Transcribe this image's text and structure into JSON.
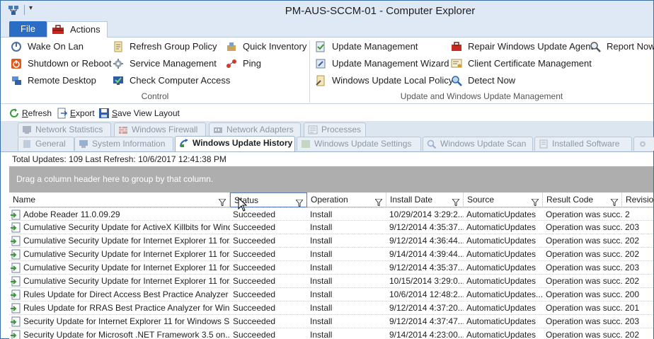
{
  "window": {
    "title": "PM-AUS-SCCM-01 - Computer Explorer"
  },
  "ribbon_tabs": {
    "file": "File",
    "actions": "Actions"
  },
  "ribbon": {
    "control": {
      "label": "Control",
      "buttons": [
        "Wake On Lan",
        "Shutdown or Reboot",
        "Remote Desktop",
        "Refresh Group Policy",
        "Service Management",
        "Check Computer Access",
        "Quick Inventory",
        "Ping"
      ]
    },
    "update": {
      "label": "Update and Windows Update Management",
      "buttons": [
        "Update Management",
        "Update Management Wizard",
        "Windows Update Local Policy",
        "Repair Windows Update Agent",
        "Client Certificate Management",
        "Detect Now",
        "Report Now"
      ]
    }
  },
  "toolbar": {
    "refresh": "Refresh",
    "export": "Export",
    "save_layout": "Save View Layout"
  },
  "subtabs": {
    "row1": [
      "Network Statistics",
      "Windows Firewall",
      "Network Adapters",
      "Processes"
    ],
    "row2": [
      "General",
      "System Information",
      "Windows Update History",
      "Windows Update Settings",
      "Windows Update Scan",
      "Installed Software"
    ],
    "active": "Windows Update History"
  },
  "info": {
    "summary": "Total Updates: 109 Last Refresh: 10/6/2017 12:41:38 PM"
  },
  "group_panel": {
    "text": "Drag a column header here to group by that column."
  },
  "grid": {
    "columns": [
      "Name",
      "Status",
      "Operation",
      "Install Date",
      "Source",
      "Result Code",
      "Revisio"
    ],
    "rows": [
      [
        "Adobe Reader 11.0.09.29",
        "Succeeded",
        "Install",
        "10/29/2014  3:29:2...",
        "AutomaticUpdates",
        "Operation was succ...",
        "2"
      ],
      [
        "Cumulative Security Update for ActiveX Killbits for Wind...",
        "Succeeded",
        "Install",
        "9/12/2014  4:35:37...",
        "AutomaticUpdates",
        "Operation was succ...",
        "203"
      ],
      [
        "Cumulative Security Update for Internet Explorer 11 for...",
        "Succeeded",
        "Install",
        "9/12/2014  4:36:44...",
        "AutomaticUpdates",
        "Operation was succ...",
        "202"
      ],
      [
        "Cumulative Security Update for Internet Explorer 11 for...",
        "Succeeded",
        "Install",
        "9/14/2014  4:39:44...",
        "AutomaticUpdates",
        "Operation was succ...",
        "202"
      ],
      [
        "Cumulative Security Update for Internet Explorer 11 for...",
        "Succeeded",
        "Install",
        "9/12/2014  4:35:37...",
        "AutomaticUpdates",
        "Operation was succ...",
        "203"
      ],
      [
        "Cumulative Security Update for Internet Explorer 11 for...",
        "Succeeded",
        "Install",
        "10/15/2014  3:29:0...",
        "AutomaticUpdates",
        "Operation was succ...",
        "202"
      ],
      [
        "Rules Update for Direct Access Best Practice Analyzer f...",
        "Succeeded",
        "Install",
        "10/6/2014  12:48:2...",
        "AutomaticUpdates...",
        "Operation was succ...",
        "200"
      ],
      [
        "Rules Update for RRAS Best Practice Analyzer for Win...",
        "Succeeded",
        "Install",
        "9/12/2014  4:37:20...",
        "AutomaticUpdates",
        "Operation was succ...",
        "201"
      ],
      [
        "Security Update for Internet Explorer 11 for Windows S...",
        "Succeeded",
        "Install",
        "9/12/2014  4:37:47...",
        "AutomaticUpdates",
        "Operation was succ...",
        "203"
      ],
      [
        "Security Update for Microsoft .NET Framework 3.5 on...",
        "Succeeded",
        "Install",
        "9/14/2014  4:23:00...",
        "AutomaticUpdates",
        "Operation was succ...",
        "202"
      ]
    ]
  },
  "colors": {
    "file_tab": "#2b6cc4",
    "titlebar": "#dfe9f5",
    "group_panel": "#aeaeae",
    "accent_green": "#3a9a3a"
  }
}
